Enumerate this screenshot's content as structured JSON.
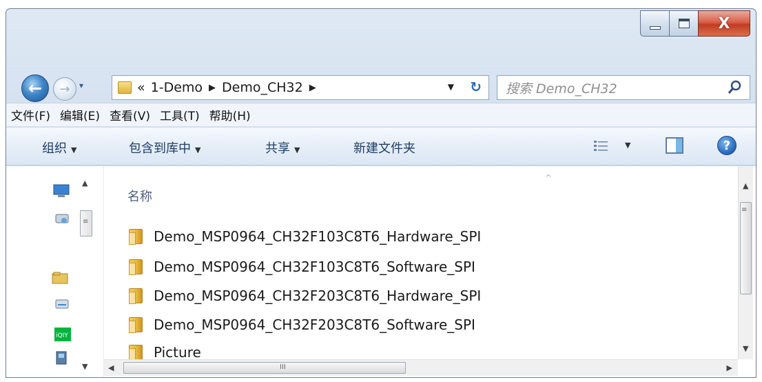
{
  "window": {
    "close_glyph": "X"
  },
  "nav": {
    "back_glyph": "←",
    "forward_glyph": "→",
    "history_glyph": "▾"
  },
  "address": {
    "overflow": "«",
    "crumbs": [
      "1-Demo",
      "Demo_CH32"
    ],
    "separator": "▶",
    "dropdown_glyph": "▼",
    "refresh_glyph": "↻"
  },
  "search": {
    "placeholder": "搜索 Demo_CH32"
  },
  "menu": {
    "items": [
      "文件(F)",
      "编辑(E)",
      "查看(V)",
      "工具(T)",
      "帮助(H)"
    ]
  },
  "commands": {
    "organize": "组织",
    "include_library": "包含到库中",
    "share": "共享",
    "new_folder": "新建文件夹",
    "caret": "▼",
    "help_glyph": "?"
  },
  "file_list": {
    "column_name": "名称",
    "sort_glyph": "^",
    "items": [
      "Demo_MSP0964_CH32F103C8T6_Hardware_SPI",
      "Demo_MSP0964_CH32F103C8T6_Software_SPI",
      "Demo_MSP0964_CH32F203C8T6_Hardware_SPI",
      "Demo_MSP0964_CH32F203C8T6_Software_SPI",
      "Picture"
    ]
  },
  "scroll": {
    "up": "▲",
    "down": "▼",
    "left": "◀",
    "right": "▶",
    "grip_v": "≡",
    "grip_h": "III"
  },
  "colors": {
    "accent": "#2e6fbe",
    "close_red": "#c23b22",
    "folder_yellow": "#e7b53a"
  }
}
